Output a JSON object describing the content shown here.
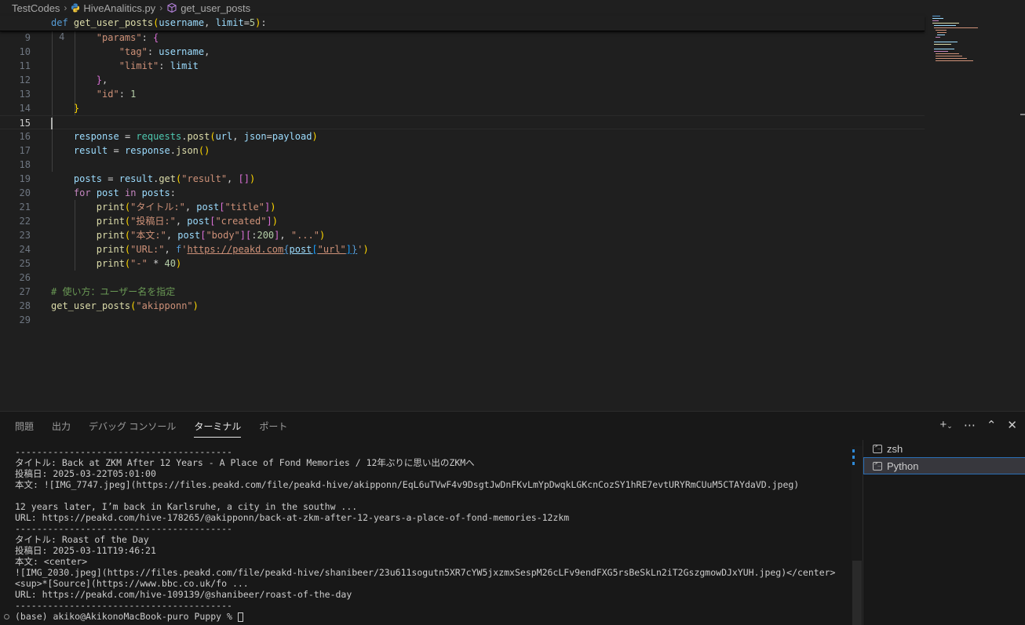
{
  "breadcrumb": {
    "folder": "TestCodes",
    "file": "HiveAnalitics.py",
    "symbol": "get_user_posts"
  },
  "editor": {
    "sticky_line_number": "4",
    "lines": [
      {
        "n": "9"
      },
      {
        "n": "10"
      },
      {
        "n": "11"
      },
      {
        "n": "12"
      },
      {
        "n": "13"
      },
      {
        "n": "14"
      },
      {
        "n": "15"
      },
      {
        "n": "16"
      },
      {
        "n": "17"
      },
      {
        "n": "18"
      },
      {
        "n": "19"
      },
      {
        "n": "20"
      },
      {
        "n": "21"
      },
      {
        "n": "22"
      },
      {
        "n": "23"
      },
      {
        "n": "24"
      },
      {
        "n": "25"
      },
      {
        "n": "26"
      },
      {
        "n": "27"
      },
      {
        "n": "28"
      },
      {
        "n": "29"
      }
    ],
    "comment_line": "# 使い方：ユーザー名を指定",
    "call_arg": "\"akipponn\""
  },
  "panel": {
    "tabs": [
      "問題",
      "出力",
      "デバッグ コンソール",
      "ターミナル",
      "ポート"
    ],
    "active_tab": "ターミナル",
    "terminals": [
      "zsh",
      "Python"
    ],
    "selected_terminal": "Python"
  },
  "terminal": {
    "lines": [
      "----------------------------------------",
      "タイトル: Back at ZKM After 12 Years - A Place of Fond Memories / 12年ぶりに思い出のZKMへ",
      "投稿日: 2025-03-22T05:01:00",
      "本文: ![IMG_7747.jpeg](https://files.peakd.com/file/peakd-hive/akipponn/EqL6uTVwF4v9DsgtJwDnFKvLmYpDwqkLGKcnCozSY1hRE7evtURYRmCUuM5CTAYdaVD.jpeg)",
      "",
      "12 years later, I’m back in Karlsruhe, a city in the southw ...",
      "URL: https://peakd.com/hive-178265/@akipponn/back-at-zkm-after-12-years-a-place-of-fond-memories-12zkm",
      "----------------------------------------",
      "タイトル: Roast of the Day",
      "投稿日: 2025-03-11T19:46:21",
      "本文: <center>",
      "![IMG_2030.jpeg](https://files.peakd.com/file/peakd-hive/shanibeer/23u611sogutn5XR7cYW5jxzmxSespM26cLFv9endFXG5rsBeSkLn2iT2GszgmowDJxYUH.jpeg)</center>",
      "<sup>*[Source](https://www.bbc.co.uk/fo ...",
      "URL: https://peakd.com/hive-109139/@shanibeer/roast-of-the-day",
      "----------------------------------------"
    ],
    "prompt": "(base) akiko@AkikonoMacBook-puro Puppy % "
  }
}
